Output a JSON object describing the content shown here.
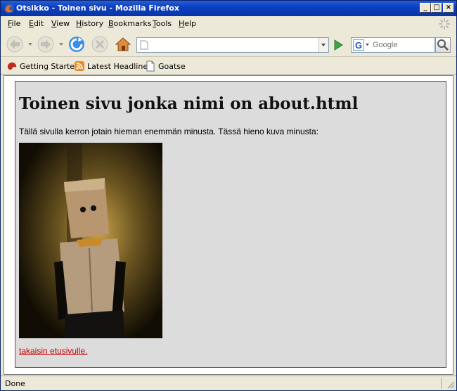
{
  "window": {
    "title": "Otsikko - Toinen sivu - Mozilla Firefox",
    "controls": {
      "minimize": "_",
      "maximize": "□",
      "close": "×"
    }
  },
  "menubar": {
    "items": [
      {
        "label": "File",
        "key": "F",
        "rest": "ile"
      },
      {
        "label": "Edit",
        "key": "E",
        "rest": "dit"
      },
      {
        "label": "View",
        "key": "V",
        "rest": "iew"
      },
      {
        "label": "History",
        "key": "H",
        "rest": "istory"
      },
      {
        "label": "Bookmarks",
        "key": "B",
        "rest": "ookmarks"
      },
      {
        "label": "Tools",
        "key": "T",
        "rest": "ools"
      },
      {
        "label": "Help",
        "key": "H",
        "rest": "elp"
      }
    ]
  },
  "navbar": {
    "url_value": "",
    "search_placeholder": "Google",
    "icons": [
      "back-icon",
      "forward-icon",
      "reload-icon",
      "stop-icon",
      "home-icon",
      "go-icon",
      "search-icon"
    ]
  },
  "bookmarks": [
    {
      "label": "Getting Started",
      "icon": "firefox-bookmark-icon"
    },
    {
      "label": "Latest Headlines",
      "icon": "rss-icon"
    },
    {
      "label": "Goatse",
      "icon": "page-icon"
    }
  ],
  "page": {
    "heading": "Toinen sivu jonka nimi on about.html",
    "paragraph": "Tällä sivulla kerron jotain hieman enemmän minusta. Tässä hieno kuva minusta:",
    "link_text": "takaisin etusivulle.",
    "photo_alt": "person with paper bag over head"
  },
  "status": {
    "text": "Done"
  },
  "colors": {
    "titlebar": "#0b3fc0",
    "chrome": "#ece9d8",
    "page_bg": "#dcdcdc",
    "link": "#cc0000"
  }
}
